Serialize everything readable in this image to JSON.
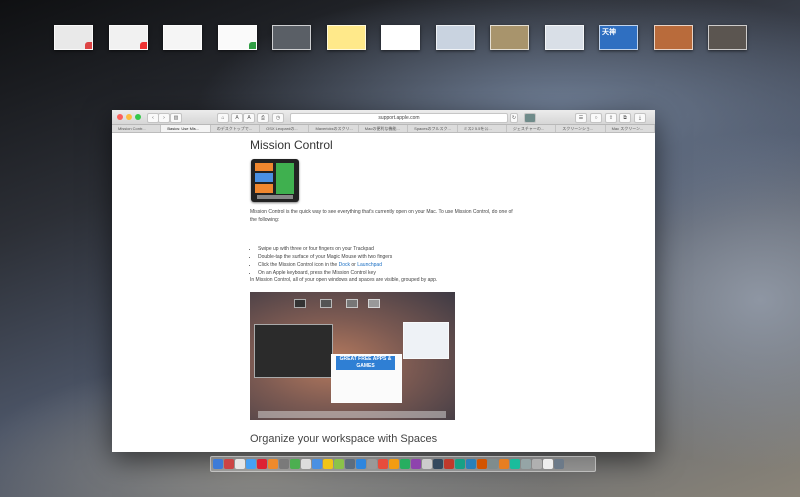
{
  "spaces": [
    {
      "name": "desktop-1",
      "bg": "#e9e9e9",
      "badge": "#d44",
      "badge_name": "calendar-icon"
    },
    {
      "name": "desktop-2",
      "bg": "#f1f1f1",
      "badge": "#e33",
      "badge_name": "music-icon"
    },
    {
      "name": "desktop-3",
      "bg": "#f5f5f5",
      "badge": null
    },
    {
      "name": "desktop-4",
      "bg": "#fafafa",
      "badge": "#2f9e44",
      "badge_name": "chrome-icon"
    },
    {
      "name": "desktop-5",
      "bg": "#5a5f66",
      "badge": null
    },
    {
      "name": "desktop-6",
      "bg": "#ffe98a",
      "badge": null
    },
    {
      "name": "desktop-7",
      "bg": "#ffffff",
      "badge": null
    },
    {
      "name": "desktop-8",
      "bg": "#c9d3e0",
      "badge": null
    },
    {
      "name": "desktop-9",
      "bg": "#a8946c",
      "badge": null
    },
    {
      "name": "desktop-10",
      "bg": "#d9dfe7",
      "badge": null
    },
    {
      "name": "desktop-11",
      "bg": "#2f6fc1",
      "badge": null,
      "label": "天神"
    },
    {
      "name": "desktop-12",
      "bg": "#b96b3b",
      "badge": null
    },
    {
      "name": "desktop-13",
      "bg": "#5b5550",
      "badge": null
    }
  ],
  "window": {
    "url": "support.apple.com",
    "tabs": [
      "Mission Contr...",
      "Basics: Use Mis...",
      "のデスクトップで...",
      "OSX Leopardの...",
      "Mavericksのスクリ...",
      "Macの便利な機能...",
      "Spacesのフルスク...",
      "ミス2 5.5を公...",
      "ジェスチャーの...",
      "スクリーンショ...",
      "Mac スクリーン..."
    ],
    "active_tab": 1
  },
  "article": {
    "title": "Mission Control",
    "intro": "Mission Control is the quick way to see everything that's currently open on your Mac. To use Mission Control, do one of the following:",
    "bullets": [
      "Swipe up with three or four fingers on your Trackpad",
      "Double-tap the surface of your Magic Mouse with two fingers"
    ],
    "bullet3_prefix": "Click the Mission Control icon in the ",
    "bullet3_link1": "Dock",
    "bullet3_mid": " or ",
    "bullet3_link2": "Launchpad",
    "bullet4": "On an Apple keyboard, press the Mission Control key",
    "visible_text": "In Mission Control, all of your open windows and spaces are visible, grouped by app.",
    "screenshot_banner": "GREAT FREE APPS & GAMES",
    "h2": "Organize your workspace with Spaces"
  },
  "dock_colors": [
    "#3d7bd8",
    "#c44",
    "#e6e6e6",
    "#46a0f3",
    "#d23",
    "#ee8a2a",
    "#7a7a7a",
    "#4caf50",
    "#dddddd",
    "#4a90e2",
    "#f0c419",
    "#8bc34a",
    "#5d6d7e",
    "#2e86de",
    "#999999",
    "#e74c3c",
    "#f39c12",
    "#27ae60",
    "#8e44ad",
    "#cccccc",
    "#34495e",
    "#c0392b",
    "#16a085",
    "#2980b9",
    "#d35400",
    "#7f8c8d",
    "#e67e22",
    "#1abc9c",
    "#95a5a6",
    "#b0b0b0",
    "#eeeeee",
    "#6c7a89"
  ]
}
